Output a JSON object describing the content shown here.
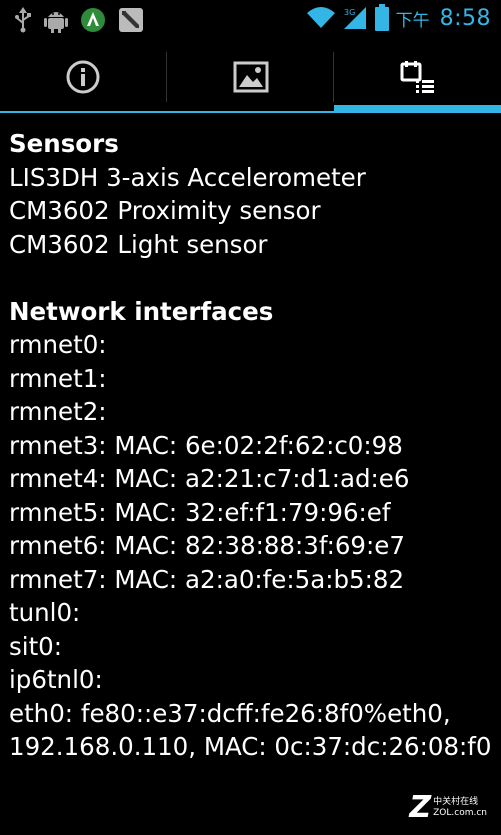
{
  "status_bar": {
    "ampm": "下午",
    "time": "8:58",
    "left_icons": [
      "usb-icon",
      "android-debug-icon",
      "app-update-icon",
      "clipboard-icon"
    ],
    "right_icons": [
      "wifi-icon",
      "signal-icon",
      "battery-icon"
    ],
    "accent_color": "#33b5e5"
  },
  "tabs": [
    {
      "name": "info-icon"
    },
    {
      "name": "image-icon"
    },
    {
      "name": "list-icon",
      "selected": true
    }
  ],
  "content": {
    "sensors_header": "Sensors",
    "sensors": [
      "LIS3DH 3-axis Accelerometer",
      "CM3602 Proximity sensor",
      "CM3602 Light sensor"
    ],
    "network_header": "Network interfaces",
    "interfaces": [
      "rmnet0:",
      "rmnet1:",
      "rmnet2:",
      "rmnet3: MAC: 6e:02:2f:62:c0:98",
      "rmnet4: MAC: a2:21:c7:d1:ad:e6",
      "rmnet5: MAC: 32:ef:f1:79:96:ef",
      "rmnet6: MAC: 82:38:88:3f:69:e7",
      "rmnet7: MAC: a2:a0:fe:5a:b5:82",
      "tunl0:",
      "sit0:",
      "ip6tnl0:",
      "eth0: fe80::e37:dcff:fe26:8f0%eth0,",
      "192.168.0.110, MAC: 0c:37:dc:26:08:f0"
    ]
  },
  "watermark": {
    "logo": "Z",
    "line1": "中关村在线",
    "line2": "ZOL.com.cn"
  }
}
